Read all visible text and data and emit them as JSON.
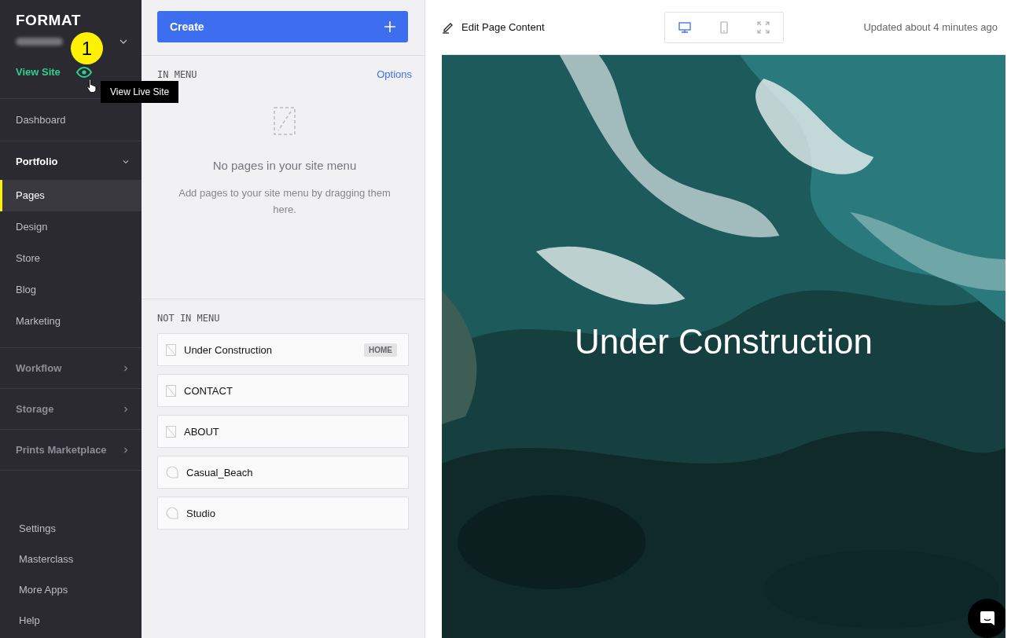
{
  "sidebar": {
    "logo": "FORMAT",
    "annotation_badge": "1",
    "view_site": "View Site",
    "tooltip": "View Live Site",
    "nav": [
      {
        "kind": "link",
        "label": "Dashboard"
      },
      {
        "kind": "section",
        "label": "Portfolio",
        "expanded": true,
        "children": [
          {
            "label": "Pages",
            "selected": true
          },
          {
            "label": "Design",
            "selected": false
          },
          {
            "label": "Store",
            "selected": false
          },
          {
            "label": "Blog",
            "selected": false
          },
          {
            "label": "Marketing",
            "selected": false
          }
        ]
      },
      {
        "kind": "section",
        "label": "Workflow",
        "expanded": false
      },
      {
        "kind": "section",
        "label": "Storage",
        "expanded": false
      },
      {
        "kind": "section",
        "label": "Prints Marketplace",
        "expanded": false
      }
    ],
    "footer": [
      "Settings",
      "Masterclass",
      "More Apps",
      "Help"
    ]
  },
  "pages_panel": {
    "create_button": "Create",
    "in_menu": {
      "heading": "IN MENU",
      "options": "Options",
      "empty_title": "No pages in your site menu",
      "empty_text": "Add pages to your site menu by dragging them here."
    },
    "not_in_menu": {
      "heading": "NOT IN MENU",
      "pages": [
        {
          "kind": "page",
          "title": "Under Construction",
          "badge": "HOME"
        },
        {
          "kind": "page",
          "title": "CONTACT"
        },
        {
          "kind": "page",
          "title": "ABOUT"
        },
        {
          "kind": "gallery",
          "title": "Casual_Beach"
        },
        {
          "kind": "gallery",
          "title": "Studio"
        }
      ]
    }
  },
  "editor": {
    "edit_link": "Edit Page Content",
    "devices": [
      {
        "kind": "desktop",
        "selected": true
      },
      {
        "kind": "mobile",
        "selected": false
      },
      {
        "kind": "fullscreen",
        "selected": false
      }
    ],
    "updated": "Updated about 4 minutes ago",
    "preview": {
      "kind": "picture",
      "title": "Under Construction"
    }
  }
}
